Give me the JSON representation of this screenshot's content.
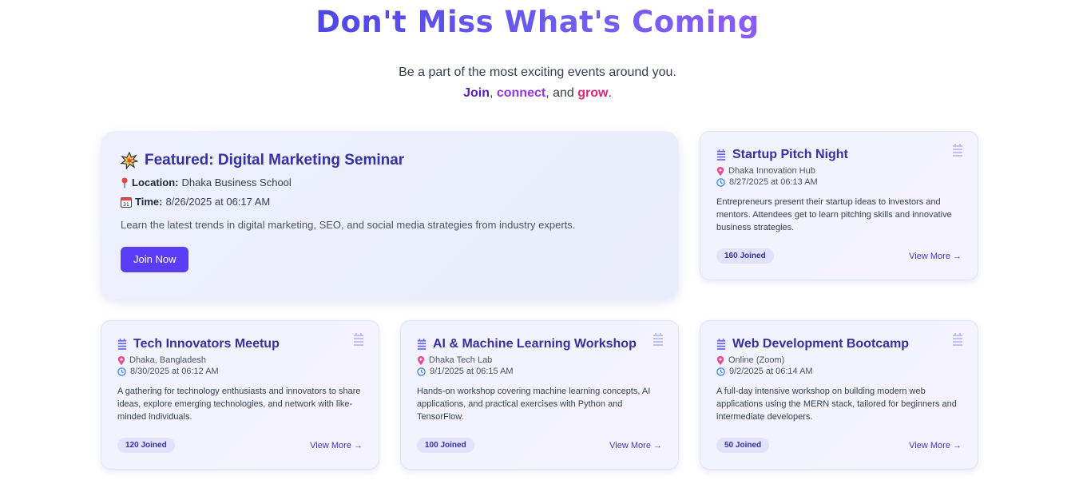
{
  "hero": {
    "title": "Don't Miss What's Coming",
    "subtitle_line1": "Be a part of the most exciting events around you.",
    "word_join": "Join",
    "sep1": ", ",
    "word_connect": "connect",
    "sep2": ", and ",
    "word_grow": "grow",
    "end": "."
  },
  "featured": {
    "title": "Featured: Digital Marketing Seminar",
    "location_label": "Location:",
    "location": "Dhaka Business School",
    "time_label": "Time:",
    "time": "8/26/2025 at 06:17 AM",
    "description": "Learn the latest trends in digital marketing, SEO, and social media strategies from industry experts.",
    "button": "Join Now"
  },
  "events": [
    {
      "title": "Startup Pitch Night",
      "location": "Dhaka Innovation Hub",
      "time": "8/27/2025 at 06:13 AM",
      "description": "Entrepreneurs present their startup ideas to investors and mentors. Attendees get to learn pitching skills and innovative business strategies.",
      "joined": "160 Joined",
      "link": "View More →"
    },
    {
      "title": "Tech Innovators Meetup",
      "location": "Dhaka, Bangladesh",
      "time": "8/30/2025 at 06:12 AM",
      "description": "A gathering for technology enthusiasts and innovators to share ideas, explore emerging technologies, and network with like-minded individuals.",
      "joined": "120 Joined",
      "link": "View More →"
    },
    {
      "title": "AI & Machine Learning Workshop",
      "location": "Dhaka Tech Lab",
      "time": "9/1/2025 at 06:15 AM",
      "description": "Hands-on workshop covering machine learning concepts, AI applications, and practical exercises with Python and TensorFlow.",
      "joined": "100 Joined",
      "link": "View More →"
    },
    {
      "title": "Web Development Bootcamp",
      "location": "Online (Zoom)",
      "time": "9/2/2025 at 06:14 AM",
      "description": "A full-day intensive workshop on building modern web applications using the MERN stack, tailored for beginners and intermediate developers.",
      "joined": "50 Joined",
      "link": "View More →"
    }
  ],
  "icons": {
    "featured": "burst-icon",
    "location": "map-pin-icon",
    "time": "calendar-icon",
    "card_title": "event-list-icon",
    "card_location": "map-pin-icon",
    "card_time": "clock-icon"
  },
  "colors": {
    "accent": "#5b3df5",
    "title": "#3730a3",
    "pin": "#ec4899",
    "clock": "#3b82f6"
  }
}
